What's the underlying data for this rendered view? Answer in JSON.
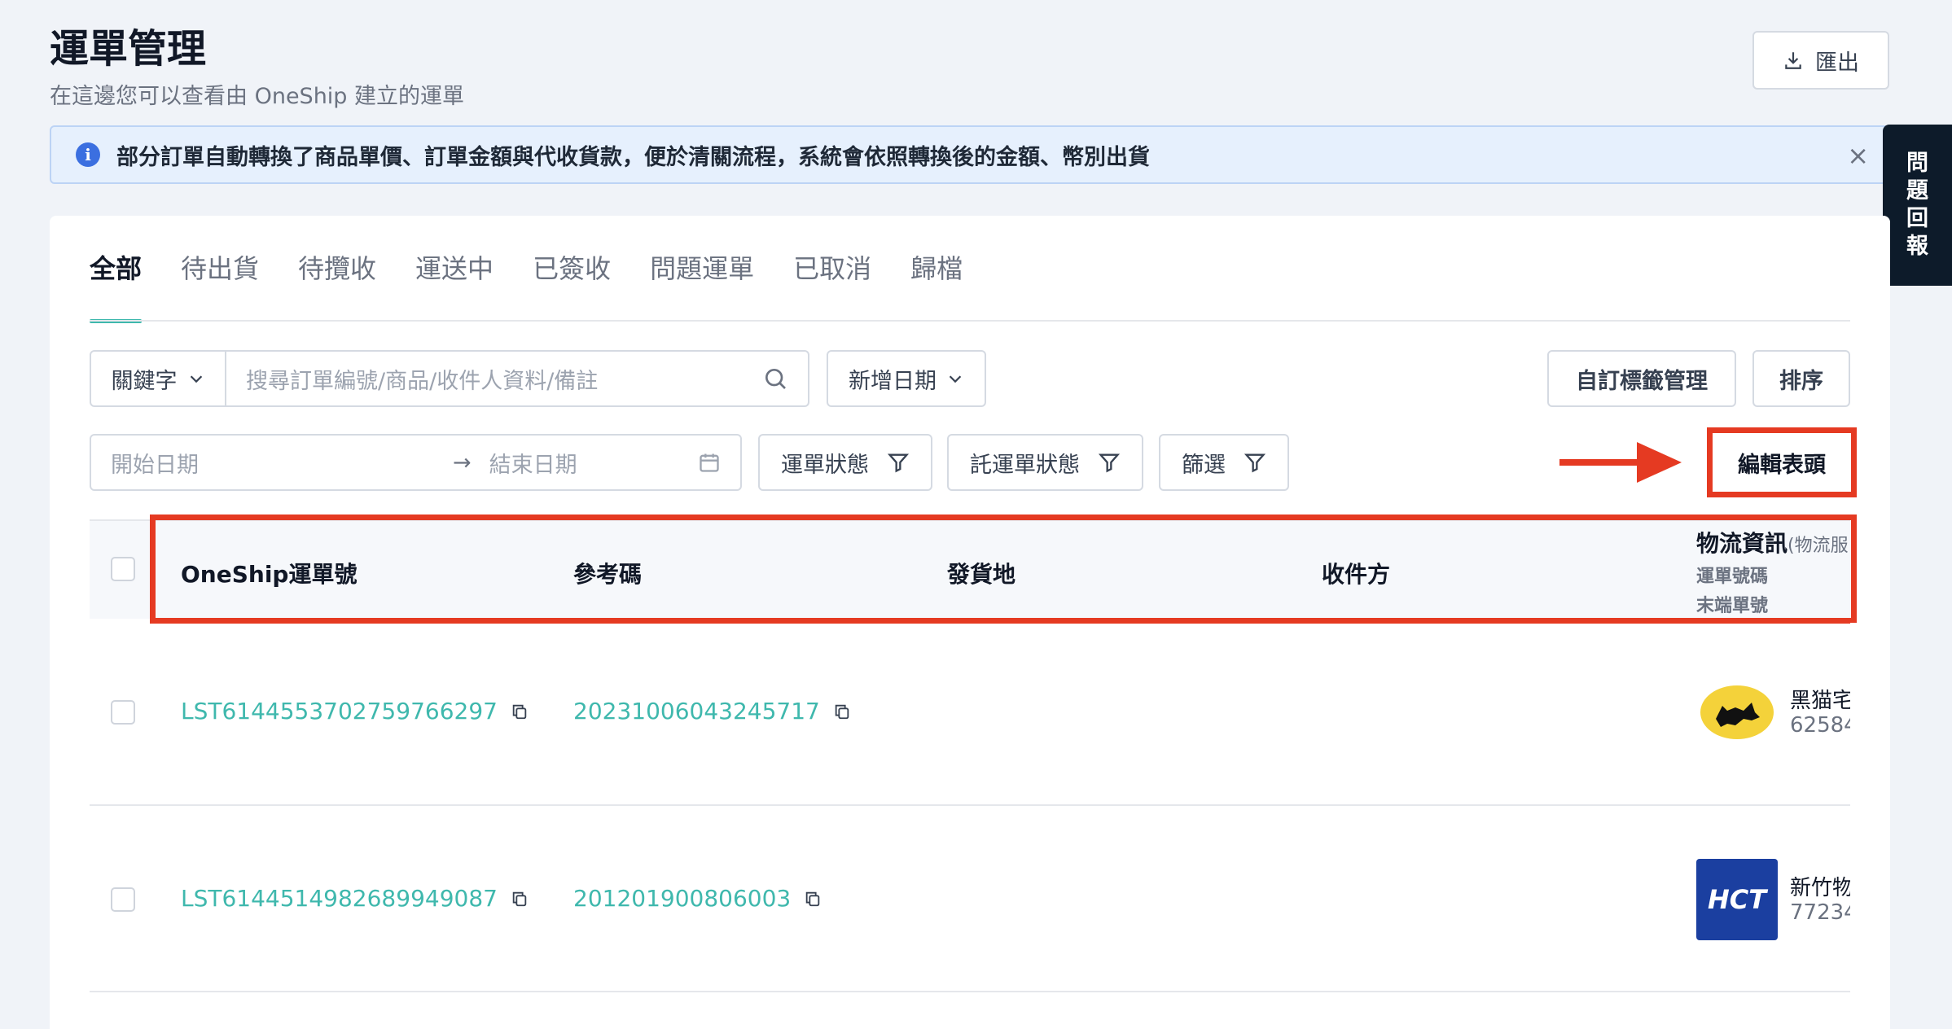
{
  "page": {
    "title": "運單管理",
    "subtitle": "在這邊您可以查看由 OneShip 建立的運單",
    "export_label": "匯出"
  },
  "banner": {
    "message": "部分訂單自動轉換了商品單價、訂單金額與代收貨款，便於清關流程，系統會依照轉換後的金額、幣別出貨",
    "close": "×"
  },
  "feedback": {
    "chars": [
      "問",
      "題",
      "回",
      "報"
    ]
  },
  "tabs": [
    {
      "label": "全部",
      "active": true
    },
    {
      "label": "待出貨"
    },
    {
      "label": "待攬收"
    },
    {
      "label": "運送中"
    },
    {
      "label": "已簽收"
    },
    {
      "label": "問題運單"
    },
    {
      "label": "已取消"
    },
    {
      "label": "歸檔"
    }
  ],
  "filters": {
    "keyword_select": "關鍵字",
    "search_placeholder": "搜尋訂單編號/商品/收件人資料/備註",
    "date_select": "新增日期",
    "tag_manage": "自訂標籤管理",
    "sort": "排序",
    "start_date": "開始日期",
    "end_date": "結束日期",
    "shipment_status": "運單狀態",
    "consignment_status": "託運單狀態",
    "filter": "篩選",
    "edit_header": "編輯表頭"
  },
  "table": {
    "headers": {
      "tracking": "OneShip運單號",
      "reference": "參考碼",
      "origin": "發貨地",
      "recipient": "收件方",
      "logistics": "物流資訊",
      "logistics_suffix": "(物流服",
      "logistics_sub1": "運單號碼",
      "logistics_sub2": "末端單號"
    },
    "rows": [
      {
        "tracking": "LST6144553702759766297",
        "reference": "20231006043245717",
        "carrier": "黑猫宅",
        "carrier_no": "62584"
      },
      {
        "tracking": "LST6144514982689949087",
        "reference": "201201900806003",
        "carrier": "新竹物",
        "carrier_no": "77234"
      }
    ]
  },
  "colors": {
    "accent": "#3fb8ad",
    "highlight": "#e53a22",
    "info": "#3b6fe0"
  }
}
